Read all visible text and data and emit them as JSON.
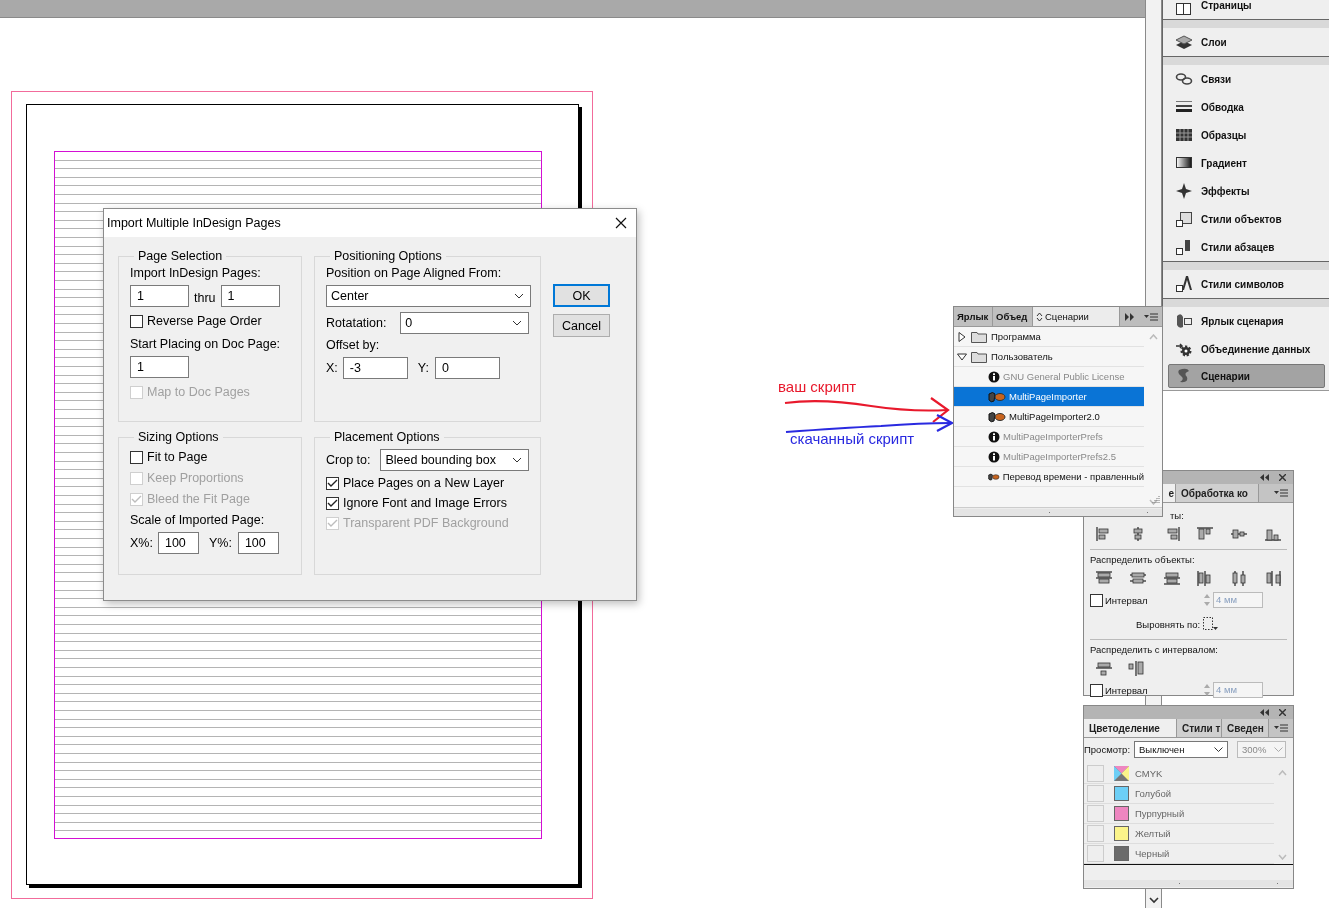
{
  "dialog": {
    "title": "Import Multiple InDesign Pages",
    "page_selection": {
      "title": "Page Selection",
      "import_label": "Import InDesign Pages:",
      "from": "1",
      "thru_label": "thru",
      "to": "1",
      "reverse_order": {
        "label": "Reverse Page Order",
        "checked": false,
        "disabled": false
      },
      "start_label": "Start Placing on Doc Page:",
      "start_page": "1",
      "map_to_doc": {
        "label": "Map to Doc Pages",
        "checked": false,
        "disabled": true
      }
    },
    "positioning": {
      "title": "Positioning Options",
      "align_label": "Position on Page Aligned From:",
      "align_value": "Center",
      "rotation_label": "Rotatation:",
      "rotation_value": "0",
      "offset_label": "Offset by:",
      "x_label": "X:",
      "x_value": "-3",
      "y_label": "Y:",
      "y_value": "0"
    },
    "sizing": {
      "title": "Sizing Options",
      "options": [
        {
          "label": "Fit to Page",
          "checked": false,
          "disabled": false
        },
        {
          "label": "Keep Proportions",
          "checked": false,
          "disabled": true
        },
        {
          "label": "Bleed the Fit Page",
          "checked": true,
          "disabled": true
        }
      ],
      "scale_label": "Scale of Imported Page:",
      "x_label": "X%:",
      "x_value": "100",
      "y_label": "Y%:",
      "y_value": "100"
    },
    "placement": {
      "title": "Placement Options",
      "crop_label": "Crop to:",
      "crop_value": "Bleed bounding box",
      "options": [
        {
          "label": "Place Pages on a New Layer",
          "checked": true,
          "disabled": false
        },
        {
          "label": "Ignore Font and Image Errors",
          "checked": true,
          "disabled": false
        },
        {
          "label": "Transparent PDF Background",
          "checked": true,
          "disabled": true
        }
      ]
    },
    "buttons": [
      {
        "label": "OK",
        "default": true
      },
      {
        "label": "Cancel",
        "default": false
      }
    ]
  },
  "annotations": [
    {
      "text": "ваш скрипт",
      "color": "#e8192c"
    },
    {
      "text": "скачанный скрипт",
      "color": "#2a2ae0"
    }
  ],
  "scripts_panel": {
    "tabs": [
      {
        "label": "Ярлык",
        "selected": false
      },
      {
        "label": "Объед",
        "selected": false
      },
      {
        "label": "Сценарии",
        "selected": true
      }
    ],
    "tree": [
      {
        "label": "Программа",
        "expanded": false
      },
      {
        "label": "Пользователь",
        "expanded": true,
        "children": [
          {
            "label": "GNU General Public License",
            "kind": "info",
            "selected": false
          },
          {
            "label": "MultiPageImporter",
            "kind": "script",
            "selected": true
          },
          {
            "label": "MultiPageImporter2.0",
            "kind": "script",
            "selected": false
          },
          {
            "label": "MultiPageImporterPrefs",
            "kind": "info",
            "selected": false
          },
          {
            "label": "MultiPageImporterPrefs2.5",
            "kind": "info",
            "selected": false
          },
          {
            "label": "Перевод времени - правленный",
            "kind": "script",
            "selected": false
          }
        ]
      }
    ]
  },
  "align_panel": {
    "tabs": [
      {
        "label": "е",
        "selected": true
      },
      {
        "label": "Обработка ко",
        "selected": false
      }
    ],
    "align_heading": "ты:",
    "distribute_heading": "Распределить объекты:",
    "spacing": {
      "label": "Интервал",
      "checked": false,
      "value": "4 мм"
    },
    "align_to_label": "Выровнять по:",
    "spacing_heading": "Распределить с интервалом:",
    "spacing2": {
      "label": "Интервал",
      "checked": false,
      "value": "4 мм"
    }
  },
  "separations_panel": {
    "tabs": [
      {
        "label": "Цветоделение",
        "selected": true
      },
      {
        "label": "Стили т",
        "selected": false
      },
      {
        "label": "Сведен",
        "selected": false
      }
    ],
    "view_label": "Просмотр:",
    "view_value": "Выключен",
    "zoom_value": "300%",
    "inks": [
      {
        "name": "CMYK",
        "kind": "composite",
        "visible": false
      },
      {
        "name": "Голубой",
        "kind": "ink",
        "color": "#6dcff6",
        "visible": false
      },
      {
        "name": "Пурпурный",
        "kind": "ink",
        "color": "#ee86c0",
        "visible": false
      },
      {
        "name": "Желтый",
        "kind": "ink",
        "color": "#fbf48a",
        "visible": false
      },
      {
        "name": "Черный",
        "kind": "ink",
        "color": "#6b6b6b",
        "visible": false
      }
    ]
  },
  "dock": {
    "groups": [
      {
        "items": [
          {
            "label": "Страницы",
            "selected": false
          }
        ]
      },
      {
        "items": [
          {
            "label": "Слои",
            "selected": false
          }
        ]
      },
      {
        "items": [
          {
            "label": "Связи",
            "selected": false
          },
          {
            "label": "Обводка",
            "selected": false
          },
          {
            "label": "Образцы",
            "selected": false
          },
          {
            "label": "Градиент",
            "selected": false
          },
          {
            "label": "Эффекты",
            "selected": false
          },
          {
            "label": "Стили объектов",
            "selected": false
          },
          {
            "label": "Стили абзацев",
            "selected": false
          }
        ]
      },
      {
        "items": [
          {
            "label": "Стили символов",
            "selected": false
          }
        ]
      },
      {
        "items": [
          {
            "label": "Ярлык сценария",
            "selected": false
          },
          {
            "label": "Объединение данных",
            "selected": false
          },
          {
            "label": "Сценарии",
            "selected": true
          }
        ]
      }
    ]
  }
}
